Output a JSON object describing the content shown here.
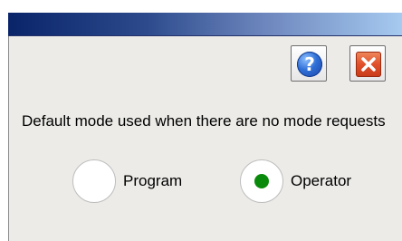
{
  "toolbar": {
    "help_icon": "help-icon",
    "help_glyph": "?",
    "close_icon": "close-icon"
  },
  "description": "Default mode used when there are no mode requests",
  "mode_options": [
    {
      "label": "Program",
      "selected": false
    },
    {
      "label": "Operator",
      "selected": true
    }
  ],
  "colors": {
    "title_bar_start": "#0a246a",
    "title_bar_end": "#a6caf0",
    "panel_background": "#ecebe8",
    "selected_radio": "#0a8a0a",
    "close_button": "#e0502a",
    "help_button": "#2f6fd6"
  }
}
